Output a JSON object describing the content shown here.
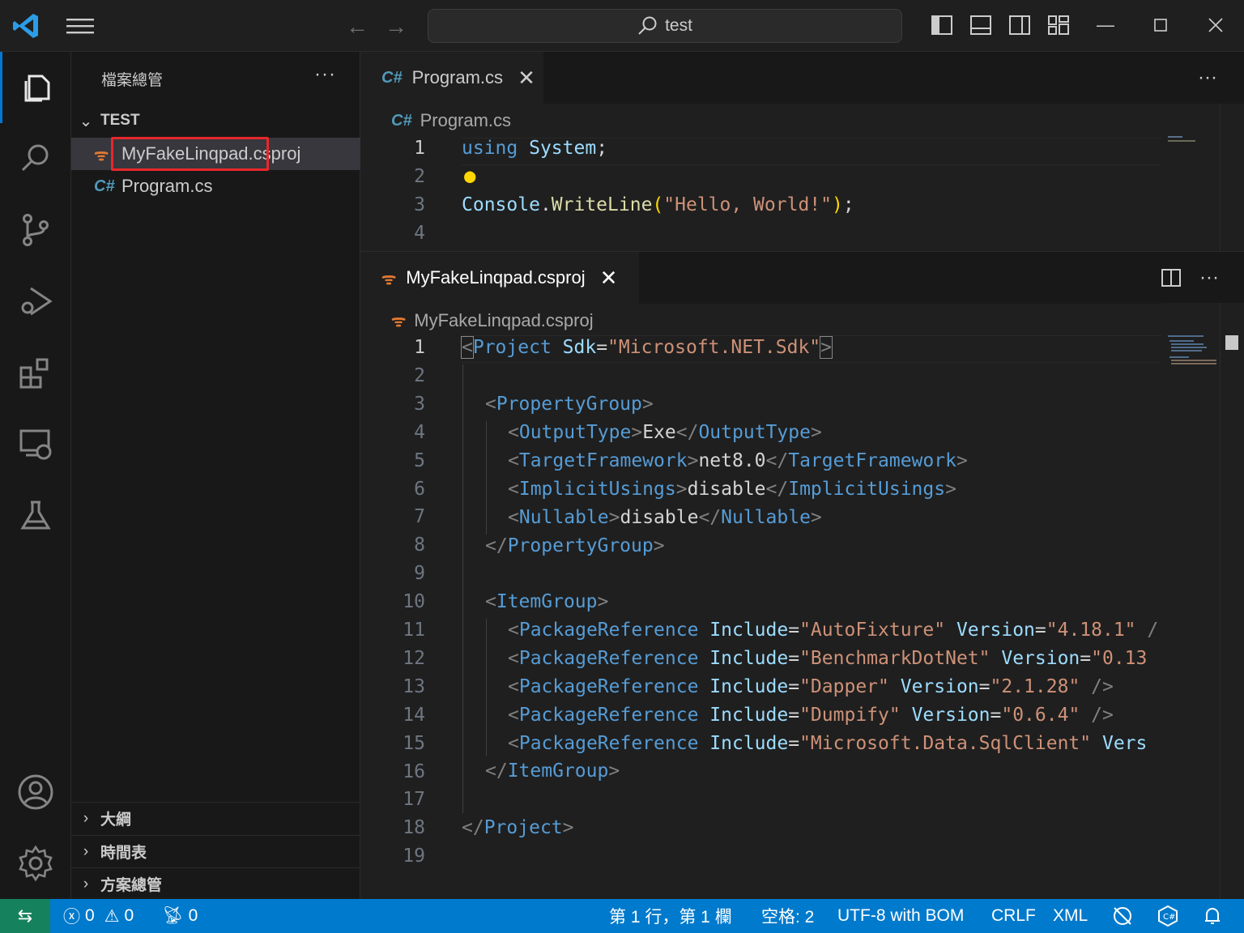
{
  "window": {
    "search_text": "test",
    "icons": [
      "vscode-logo-icon",
      "hamburger-menu-icon",
      "back-arrow-icon",
      "forward-arrow-icon",
      "search-icon",
      "toggle-primary-sidebar-icon",
      "toggle-panel-icon",
      "toggle-secondary-sidebar-icon",
      "customize-layout-icon",
      "minimize-icon",
      "maximize-icon",
      "close-icon"
    ]
  },
  "activity_bar": {
    "items": [
      "explorer-icon",
      "search-icon",
      "source-control-icon",
      "run-debug-icon",
      "extensions-icon",
      "remote-explorer-icon",
      "testing-icon"
    ],
    "bottom": [
      "accounts-icon",
      "manage-gear-icon"
    ]
  },
  "sidebar": {
    "title": "檔案總管",
    "more": "···",
    "folder": "TEST",
    "files": [
      {
        "name": "MyFakeLinqpad.csproj",
        "icon": "rss-icon",
        "selected": true
      },
      {
        "name": "Program.cs",
        "icon": "csharp-icon",
        "selected": false
      }
    ],
    "bottom_sections": [
      "大綱",
      "時間表",
      "方案總管"
    ]
  },
  "editor_top": {
    "tab_label": "Program.cs",
    "breadcrumb": "Program.cs",
    "more": "···",
    "lines": [
      {
        "n": "1"
      },
      {
        "n": "2"
      },
      {
        "n": "3"
      },
      {
        "n": "4"
      }
    ],
    "code": {
      "l1_kw": "using",
      "l1_ns": "System",
      "l1_end": ";",
      "l3_cls": "Console",
      "l3_dot": ".",
      "l3_fn": "WriteLine",
      "l3_po": "(",
      "l3_str": "\"Hello, World!\"",
      "l3_pc": ")",
      "l3_end": ";"
    }
  },
  "editor_bottom": {
    "tab_label": "MyFakeLinqpad.csproj",
    "breadcrumb": "MyFakeLinqpad.csproj",
    "more": "···",
    "line_numbers": [
      "1",
      "2",
      "3",
      "4",
      "5",
      "6",
      "7",
      "8",
      "9",
      "10",
      "11",
      "12",
      "13",
      "14",
      "15",
      "16",
      "17",
      "18",
      "19"
    ],
    "code": {
      "project_open_tag": "Project",
      "sdk_attr": "Sdk",
      "sdk_val": "\"Microsoft.NET.Sdk\"",
      "propgroup": "PropertyGroup",
      "outputtype": "OutputType",
      "outputtype_val": "Exe",
      "tfm": "TargetFramework",
      "tfm_val": "net8.0",
      "implicit": "ImplicitUsings",
      "implicit_val": "disable",
      "nullable": "Nullable",
      "nullable_val": "disable",
      "itemgroup": "ItemGroup",
      "pkgref": "PackageReference",
      "include": "Include",
      "version": "Version",
      "packages": [
        {
          "name": "\"AutoFixture\"",
          "version_val": "\"4.18.1\"",
          "tail": " /"
        },
        {
          "name": "\"BenchmarkDotNet\"",
          "version_val": "\"0.13",
          "tail": ""
        },
        {
          "name": "\"Dapper\"",
          "version_val": "\"2.1.28\"",
          "tail": " />"
        },
        {
          "name": "\"Dumpify\"",
          "version_val": "\"0.6.4\"",
          "tail": " />"
        },
        {
          "name": "\"Microsoft.Data.SqlClient\"",
          "version_val": "",
          "tail": "Vers"
        }
      ]
    }
  },
  "status_bar": {
    "errors": "0",
    "warnings": "0",
    "ports": "0",
    "position": "第 1 行，第 1 欄",
    "indent": "空格: 2",
    "encoding": "UTF-8 with BOM",
    "eol": "CRLF",
    "language": "XML",
    "colors": {
      "bar": "#007acc",
      "remote": "#16825d"
    }
  }
}
